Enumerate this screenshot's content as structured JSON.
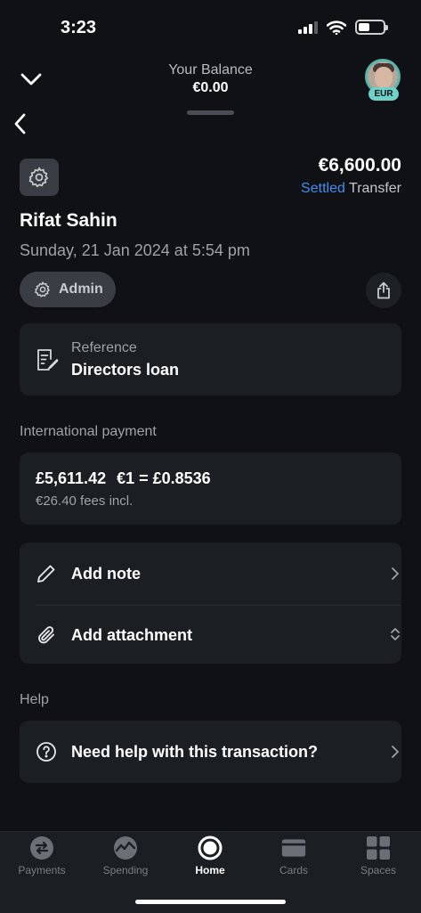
{
  "status_bar": {
    "time": "3:23"
  },
  "header": {
    "balance_label": "Your Balance",
    "balance_value": "€0.00",
    "currency_badge": "EUR"
  },
  "transaction": {
    "amount": "€6,600.00",
    "status": "Settled",
    "type": "Transfer",
    "merchant": "Rifat Sahin",
    "datetime": "Sunday, 21 Jan 2024 at 5:54 pm",
    "category": "Admin"
  },
  "reference": {
    "label": "Reference",
    "value": "Directors loan"
  },
  "international": {
    "section_label": "International payment",
    "converted_amount": "£5,611.42",
    "rate": "€1 = £0.8536",
    "fees": "€26.40 fees incl."
  },
  "actions": {
    "add_note": "Add note",
    "add_attachment": "Add attachment"
  },
  "help": {
    "section_label": "Help",
    "question": "Need help with this transaction?"
  },
  "tabs": [
    {
      "label": "Payments",
      "icon": "payments-icon"
    },
    {
      "label": "Spending",
      "icon": "spending-icon"
    },
    {
      "label": "Home",
      "icon": "home-icon",
      "active": true
    },
    {
      "label": "Cards",
      "icon": "cards-icon"
    },
    {
      "label": "Spaces",
      "icon": "spaces-icon"
    }
  ],
  "colors": {
    "accent_blue": "#3f8ef0",
    "badge_teal": "#6fd1c8",
    "background": "#0f1115",
    "card": "#1b1e23"
  }
}
